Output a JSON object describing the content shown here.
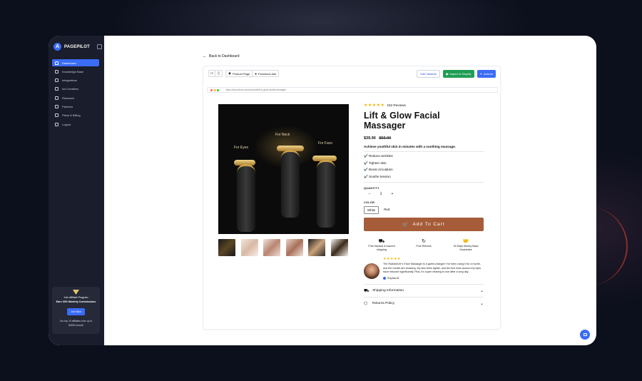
{
  "app": {
    "brand": "PAGEPILOT"
  },
  "sidebar": {
    "items": [
      {
        "label": "Dashboard",
        "icon": "home-icon",
        "active": true
      },
      {
        "label": "Knowledge Base",
        "icon": "book-icon"
      },
      {
        "label": "Integrations",
        "icon": "plug-icon"
      },
      {
        "label": "Ad Creatives",
        "icon": "wand-icon"
      },
      {
        "label": "Research",
        "icon": "tag-icon"
      },
      {
        "label": "Partners",
        "icon": "users-icon"
      },
      {
        "label": "Plans & Billing",
        "icon": "card-icon"
      },
      {
        "label": "Logout",
        "icon": "logout-icon"
      }
    ],
    "affiliate": {
      "title": "Join Affiliate Program",
      "subtitle": "Earn 30% Monthly Commissions",
      "button": "Join Now",
      "footer_1": "Our top 10 affiliates earn up to",
      "footer_2": "$3000 /month"
    }
  },
  "header": {
    "back_label": "Back to Dashboard"
  },
  "toolbar": {
    "tab_product": "Product Page",
    "tab_facebook": "Facebook Ads",
    "edit_variants": "Edit Variants",
    "import_shopify": "Import in Shopify",
    "actions": "Actions"
  },
  "preview": {
    "url": "https://yourstore.com/product/lift-&-glow-facial-massager"
  },
  "image_labels": {
    "neck": "For Neck",
    "eyes": "For Eyes",
    "face": "For Face"
  },
  "product": {
    "rating": 5,
    "reviews": "152 Reviews",
    "title": "Lift & Glow Facial Massager",
    "price": "$39.90",
    "compare_price": "$59.90",
    "tagline": "Achieve youthful skin in minutes with a soothing massage.",
    "features": [
      "✔️ Reduce wrinkles",
      "✔️ Tighten skin",
      "✔️ Boost circulation",
      "✔️ Soothe tension"
    ],
    "quantity_label": "QUANTITY",
    "quantity": "1",
    "minus": "−",
    "plus": "+",
    "color_label": "COLOR",
    "colors": [
      "White",
      "Red"
    ],
    "selected_color": "White",
    "add_to_cart": "Add To Cart",
    "perks": [
      {
        "icon": "truck-icon",
        "line1": "Free tracked & insured",
        "line2": "shipping"
      },
      {
        "icon": "return-icon",
        "line1": "Free Returns",
        "line2": ""
      },
      {
        "icon": "handshake-icon",
        "line1": "30 Days Money Back",
        "line2": "Guarantee"
      }
    ],
    "review": {
      "text": "The RadiantLift V-Face Massager is a game-changer! I've been using it for a month, and the results are amazing. My skin feels tighter, and the fine lines around my eyes have reduced significantly. Plus, it's super relaxing to use after a long day.",
      "author": "Sophia M."
    },
    "accordion": [
      "Shipping Information",
      "Returns Policy"
    ]
  },
  "colors": {
    "accent": "#3b6cf6",
    "cart": "#a65c39",
    "green": "#1f9d55",
    "sidebar": "#1a1d2b"
  }
}
